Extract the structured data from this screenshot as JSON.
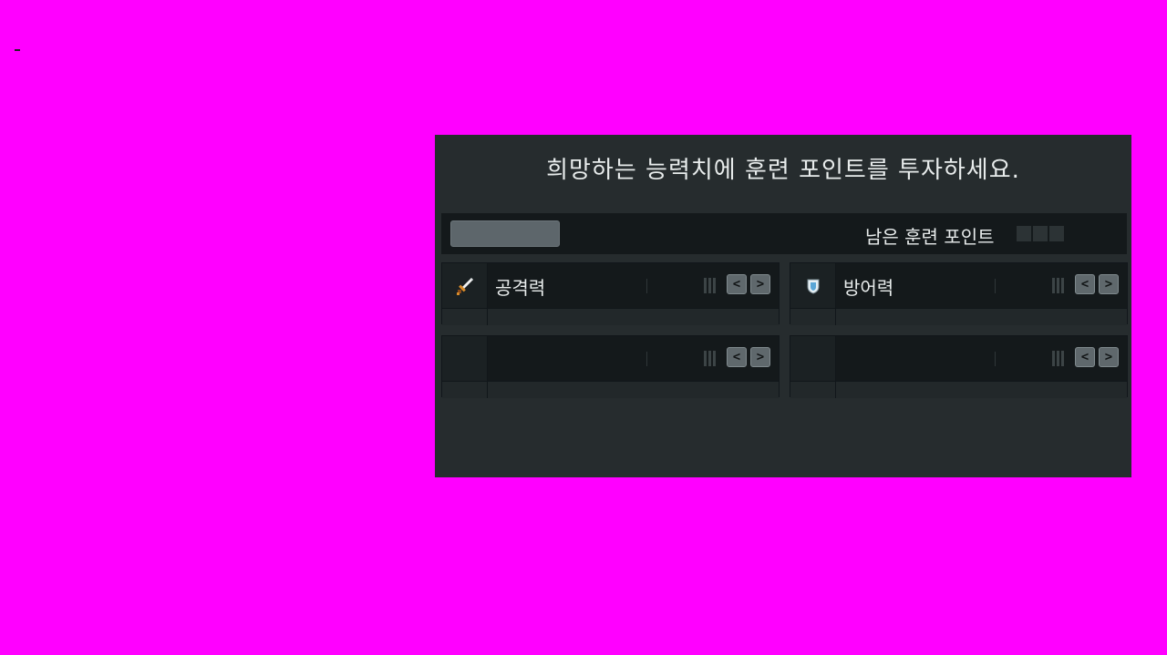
{
  "panel": {
    "title": "희망하는 능력치에 훈련 포인트를 투자하세요.",
    "remaining_points_label": "남은 훈련 포인트",
    "remaining_point_slots": 3
  },
  "stats": [
    {
      "name": "공격력",
      "icon": "sword-icon"
    },
    {
      "name": "방어력",
      "icon": "shield-icon"
    },
    {
      "name": "",
      "icon": ""
    },
    {
      "name": "",
      "icon": ""
    }
  ],
  "arrows": {
    "left": "<",
    "right": ">"
  },
  "colors": {
    "background": "#ff00ff",
    "panel": "#262c2e",
    "bar": "#14191b",
    "button": "#5d666b"
  }
}
